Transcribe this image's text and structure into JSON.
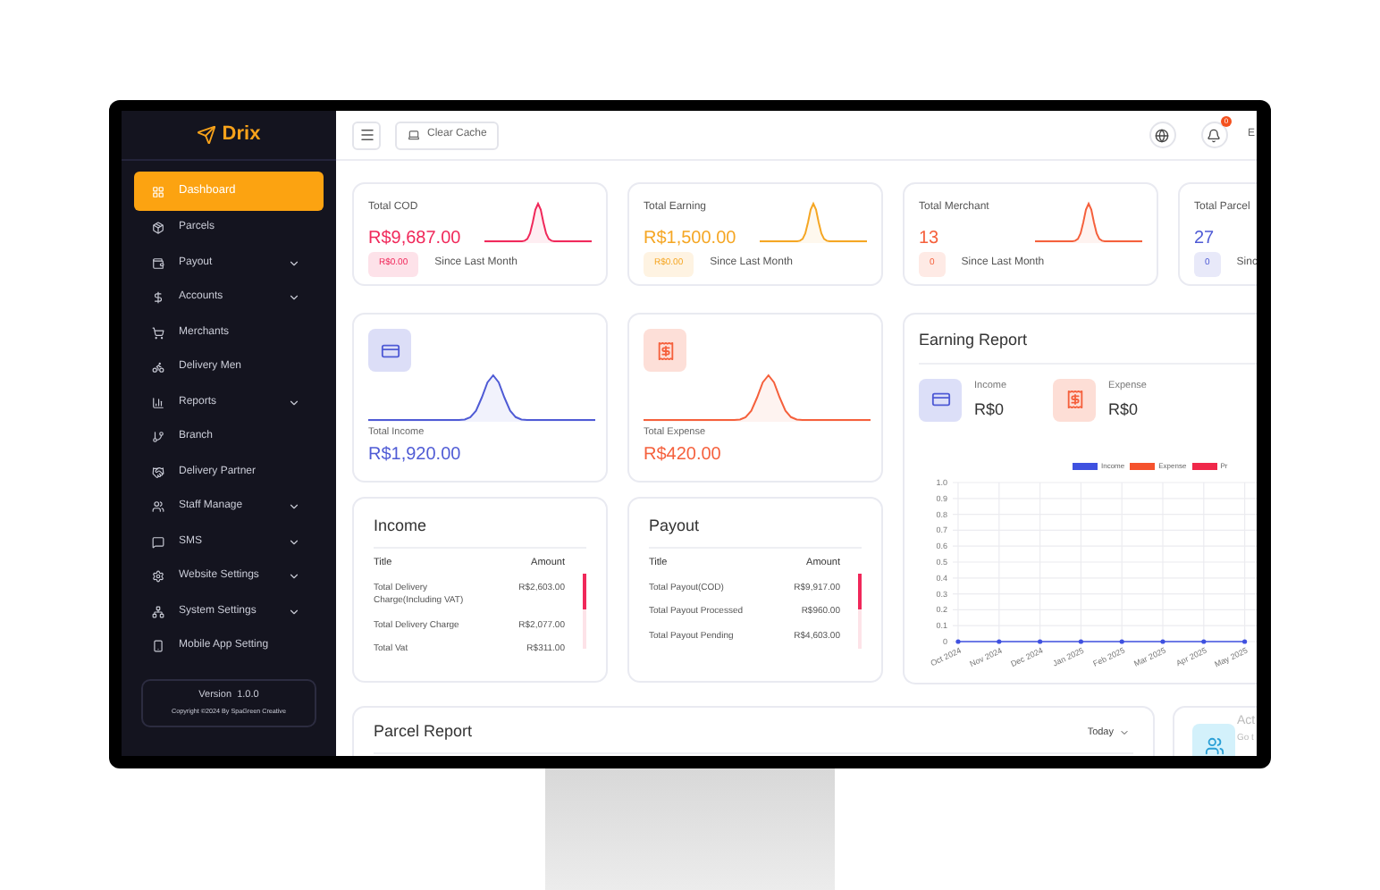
{
  "sidebar": {
    "logo": "Drix",
    "items": [
      {
        "label": "Dashboard",
        "selected": true,
        "has_submenu": false
      },
      {
        "label": "Parcels",
        "selected": false,
        "has_submenu": false
      },
      {
        "label": "Payout",
        "selected": false,
        "has_submenu": true
      },
      {
        "label": "Accounts",
        "selected": false,
        "has_submenu": true
      },
      {
        "label": "Merchants",
        "selected": false,
        "has_submenu": false
      },
      {
        "label": "Delivery Men",
        "selected": false,
        "has_submenu": false
      },
      {
        "label": "Reports",
        "selected": false,
        "has_submenu": true
      },
      {
        "label": "Branch",
        "selected": false,
        "has_submenu": false
      },
      {
        "label": "Delivery Partner",
        "selected": false,
        "has_submenu": false
      },
      {
        "label": "Staff Manage",
        "selected": false,
        "has_submenu": true
      },
      {
        "label": "SMS",
        "selected": false,
        "has_submenu": true
      },
      {
        "label": "Website Settings",
        "selected": false,
        "has_submenu": true
      },
      {
        "label": "System Settings",
        "selected": false,
        "has_submenu": true
      },
      {
        "label": "Mobile App Setting",
        "selected": false,
        "has_submenu": false
      }
    ],
    "version": "Version  1.0.0",
    "copyright": "Copyright ©2024 By SpaGreen Creative"
  },
  "header": {
    "clear_cache": "Clear Cache",
    "notification_count": "0",
    "language": "E"
  },
  "stats": [
    {
      "title": "Total COD",
      "value": "R$9,687.00",
      "change": "R$0.00",
      "note": "Since Last Month",
      "color": "#f0285a"
    },
    {
      "title": "Total Earning",
      "value": "R$1,500.00",
      "change": "R$0.00",
      "note": "Since Last Month",
      "color": "#f5a623"
    },
    {
      "title": "Total Merchant",
      "value": "13",
      "change": "0",
      "note": "Since Last Month",
      "color": "#f5603c"
    },
    {
      "title": "Total Parcel",
      "value": "27",
      "change": "0",
      "note": "Sinc",
      "color": "#4f5bd5"
    }
  ],
  "totals": [
    {
      "title": "Total Income",
      "value": "R$1,920.00",
      "color": "#4f5bd5"
    },
    {
      "title": "Total Expense",
      "value": "R$420.00",
      "color": "#f5603c"
    }
  ],
  "tables": [
    {
      "title": "Income",
      "columns": [
        "Title",
        "Amount"
      ],
      "rows": [
        [
          "Total Delivery Charge(Including VAT)",
          "R$2,603.00"
        ],
        [
          "Total Delivery Charge",
          "R$2,077.00"
        ],
        [
          "Total Vat",
          "R$311.00"
        ]
      ]
    },
    {
      "title": "Payout",
      "columns": [
        "Title",
        "Amount"
      ],
      "rows": [
        [
          "Total Payout(COD)",
          "R$9,917.00"
        ],
        [
          "Total Payout Processed",
          "R$960.00"
        ],
        [
          "Total Payout Pending",
          "R$4,603.00"
        ]
      ]
    }
  ],
  "earning_report": {
    "title": "Earning Report",
    "summary": [
      {
        "label": "Income",
        "value": "R$0"
      },
      {
        "label": "Expense",
        "value": "R$0"
      }
    ],
    "chart_data": {
      "type": "line",
      "categories": [
        "Oct 2024",
        "Nov 2024",
        "Dec 2024",
        "Jan 2025",
        "Feb 2025",
        "Mar 2025",
        "Apr 2025",
        "May 2025"
      ],
      "series": [
        {
          "name": "Income",
          "color": "#3f51e0",
          "values": [
            0,
            0,
            0,
            0,
            0,
            0,
            0,
            0
          ]
        },
        {
          "name": "Expense",
          "color": "#f5522d",
          "values": [
            null,
            null,
            null,
            null,
            null,
            null,
            null,
            null
          ]
        },
        {
          "name": "Pr",
          "color": "#f0284a",
          "values": [
            null,
            null,
            null,
            null,
            null,
            null,
            null,
            null
          ]
        }
      ],
      "grid": true,
      "ylim": [
        0,
        1
      ],
      "yticks": [
        0,
        0.1,
        0.2,
        0.3,
        0.4,
        0.5,
        0.6,
        0.7,
        0.8,
        0.9,
        {
          "value": 1,
          "label": "1.0"
        }
      ]
    }
  },
  "parcel_report": {
    "title": "Parcel Report",
    "period": "Today"
  },
  "activity": {
    "title": "Act",
    "subtitle": "Go t"
  }
}
